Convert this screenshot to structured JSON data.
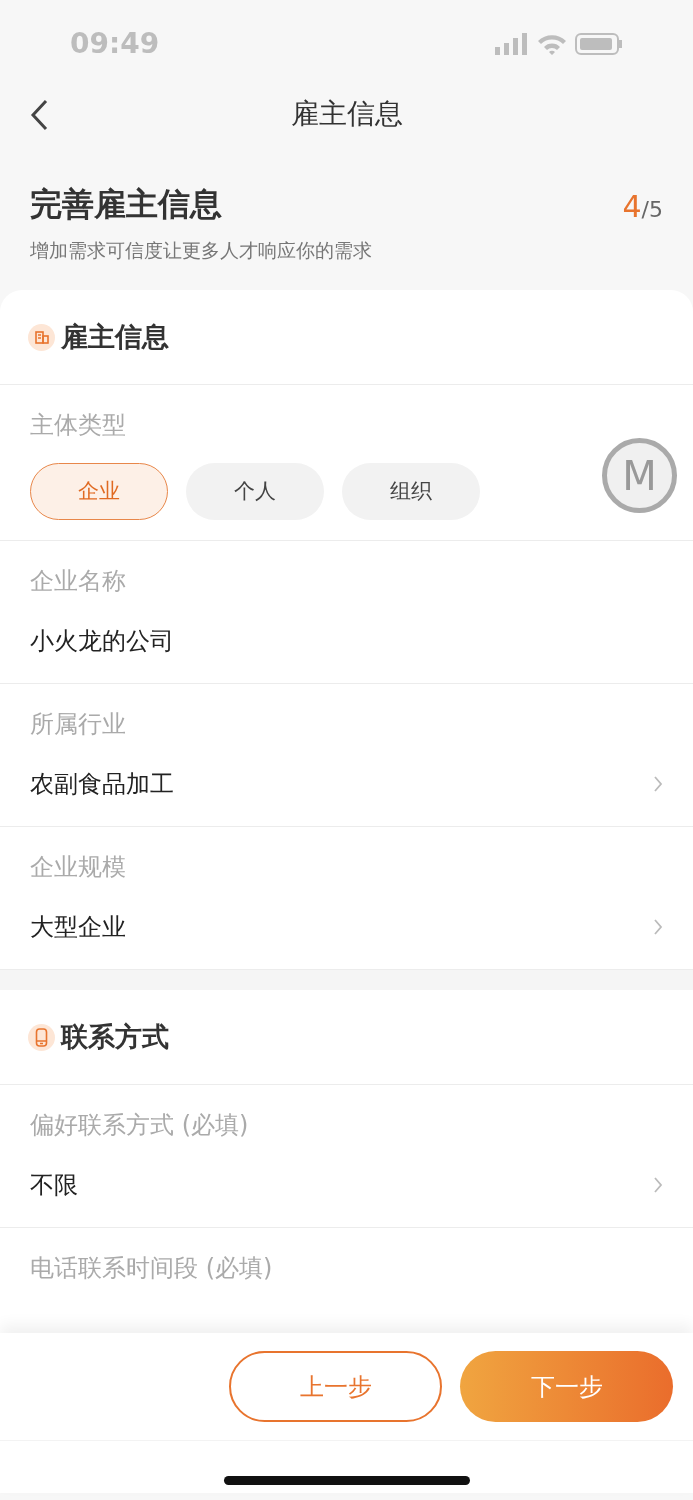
{
  "status_bar": {
    "time": "09:49"
  },
  "nav": {
    "title": "雇主信息"
  },
  "header": {
    "title": "完善雇主信息",
    "subtitle": "增加需求可信度让更多人才响应你的需求",
    "step_current": "4",
    "step_total": "/5"
  },
  "sections": [
    {
      "title": "雇主信息",
      "fields": [
        {
          "kind": "choice",
          "label": "主体类型",
          "options": [
            {
              "label": "企业",
              "selected": true
            },
            {
              "label": "个人",
              "selected": false
            },
            {
              "label": "组织",
              "selected": false
            }
          ]
        },
        {
          "kind": "text",
          "label": "企业名称",
          "value": "小火龙的公司"
        },
        {
          "kind": "select",
          "label": "所属行业",
          "value": "农副食品加工"
        },
        {
          "kind": "select",
          "label": "企业规模",
          "value": "大型企业"
        }
      ]
    },
    {
      "title": "联系方式",
      "fields": [
        {
          "kind": "select",
          "label": "偏好联系方式 (必填)",
          "value": "不限"
        },
        {
          "kind": "select",
          "label": "电话联系时间段 (必填)"
        }
      ]
    }
  ],
  "float_button": {
    "label": "M"
  },
  "footer": {
    "buttons": [
      {
        "label": "上一步",
        "kind": "outline"
      },
      {
        "label": "下一步",
        "kind": "primary"
      }
    ]
  }
}
